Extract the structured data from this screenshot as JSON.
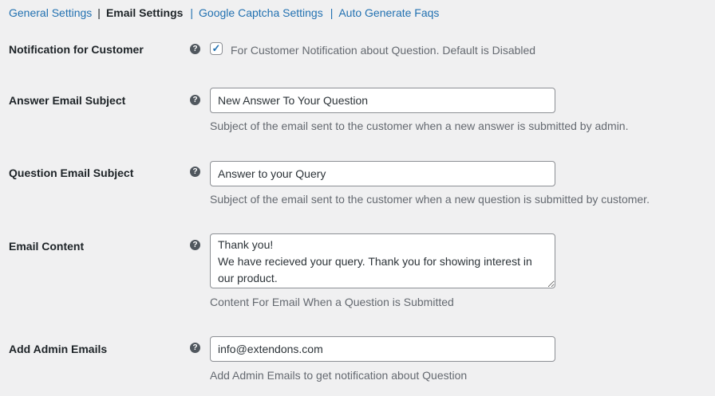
{
  "nav": {
    "general": "General Settings",
    "email": "Email Settings",
    "captcha": "Google Captcha Settings",
    "faqs": "Auto Generate Faqs",
    "sep": "|"
  },
  "help_icon": "?",
  "rows": {
    "notification": {
      "label": "Notification for Customer",
      "checked": true,
      "check_label": "For Customer Notification about Question. Default is Disabled"
    },
    "answer_subject": {
      "label": "Answer Email Subject",
      "value": "New Answer To Your Question",
      "desc": "Subject of the email sent to the customer when a new answer is submitted by admin."
    },
    "question_subject": {
      "label": "Question Email Subject",
      "value": "Answer to your Query",
      "desc": "Subject of the email sent to the customer when a new question is submitted by customer."
    },
    "content": {
      "label": "Email Content",
      "value": "Thank you!\nWe have recieved your query. Thank you for showing interest in our product.",
      "desc": "Content For Email When a Question is Submitted"
    },
    "admin_emails": {
      "label": "Add Admin Emails",
      "value": "info@extendons.com",
      "desc": "Add Admin Emails to get notification about Question"
    }
  }
}
